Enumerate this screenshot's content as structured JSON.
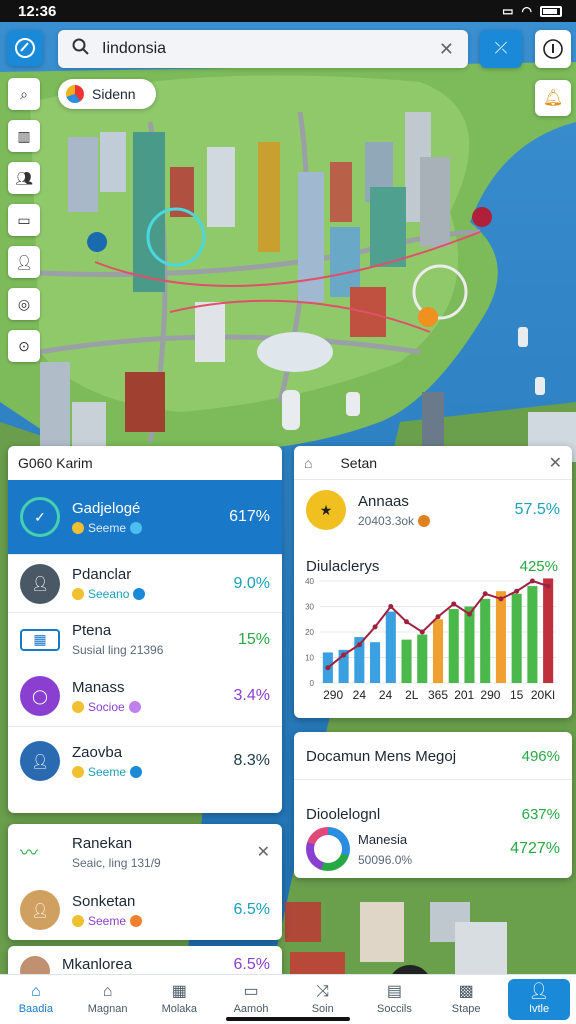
{
  "status": {
    "time": "12:36"
  },
  "search": {
    "value": "Iindonsia",
    "icon": "search-icon"
  },
  "location_chip": {
    "label": "Sidenn"
  },
  "colors": {
    "accent": "#1a8ad8",
    "green": "#27a844",
    "purple": "#8a3fd0",
    "teal": "#1aa0b8"
  },
  "left_panel": {
    "header": "G060 Karim",
    "rows": [
      {
        "title": "Gadjelogé",
        "sub": "Seeme",
        "pct": "617%",
        "color": "#1aa0b8",
        "selected": true
      },
      {
        "title": "Pdanclar",
        "sub": "Seeano",
        "pct": "9.0%",
        "color": "#1aa0b8"
      },
      {
        "title": "Ptena",
        "sub": "Susial ling 21396",
        "pct": "15%",
        "color": "#27a844"
      },
      {
        "title": "Manass",
        "sub": "Socioe",
        "pct": "3.4%",
        "color": "#8a3fd0"
      },
      {
        "title": "Zaovba",
        "sub": "Seeme",
        "pct": "8.3%",
        "color": "#1aa0b8"
      }
    ]
  },
  "left_panel2": {
    "header": "Ranekan",
    "header_sub": "Seaic, ling 131/9",
    "rows": [
      {
        "title": "Sonketan",
        "sub": "Seeme",
        "pct": "6.5%",
        "color": "#1aa0b8"
      }
    ]
  },
  "left_panel3": {
    "title": "Mkanlorea",
    "pct": "6.5%"
  },
  "right_card": {
    "header": "Setan",
    "top_title": "Annaas",
    "top_sub": "20403.3ok",
    "top_pct": "57.5%",
    "chart_title": "Diulaclerys",
    "chart_pct": "425%"
  },
  "chart_data": {
    "type": "bar",
    "title": "Diulaclerys",
    "categories": [
      "290",
      "24",
      "24",
      "2L",
      "365",
      "201",
      "290",
      "15",
      "20Kl"
    ],
    "y_ticks": [
      "0",
      "10",
      "20",
      "30",
      "40"
    ],
    "ylim": [
      0,
      40
    ],
    "series": [
      {
        "values": [
          12,
          13,
          18,
          16,
          28,
          17,
          19,
          25,
          29,
          30,
          33,
          36,
          35,
          38,
          41
        ],
        "colors": [
          "#3aa0e0",
          "#3aa0e0",
          "#3aa0e0",
          "#3aa0e0",
          "#3aa0e0",
          "#4ab84a",
          "#4ab84a",
          "#f0a030",
          "#4ab84a",
          "#4ab84a",
          "#4ab84a",
          "#f0a030",
          "#4ab84a",
          "#4ab84a",
          "#c0303c"
        ]
      },
      {
        "values": [
          6,
          11,
          15,
          22,
          30,
          24,
          20,
          26,
          31,
          27,
          35,
          33,
          36,
          40,
          38
        ],
        "line_color": "#a02040"
      }
    ]
  },
  "right_card2": {
    "title": "Docamun Mens Megoj",
    "title_pct": "496%",
    "sub_title": "Dioolelognl",
    "sub_pct": "637%",
    "donut_label": "Manesia",
    "donut_sub": "50096.0%",
    "donut_pct": "4727%"
  },
  "bottom_nav": [
    {
      "label": "Baadia",
      "icon": "home-icon",
      "active": true
    },
    {
      "label": "Magnan",
      "icon": "house-outline-icon"
    },
    {
      "label": "Molaka",
      "icon": "map-grid-icon"
    },
    {
      "label": "Aamoh",
      "icon": "bookmark-icon"
    },
    {
      "label": "Soin",
      "icon": "route-icon"
    },
    {
      "label": "Soccils",
      "icon": "card-icon"
    },
    {
      "label": "Stape",
      "icon": "apps-icon"
    },
    {
      "label": "Ivtle",
      "icon": "profile-icon",
      "button": true
    }
  ]
}
